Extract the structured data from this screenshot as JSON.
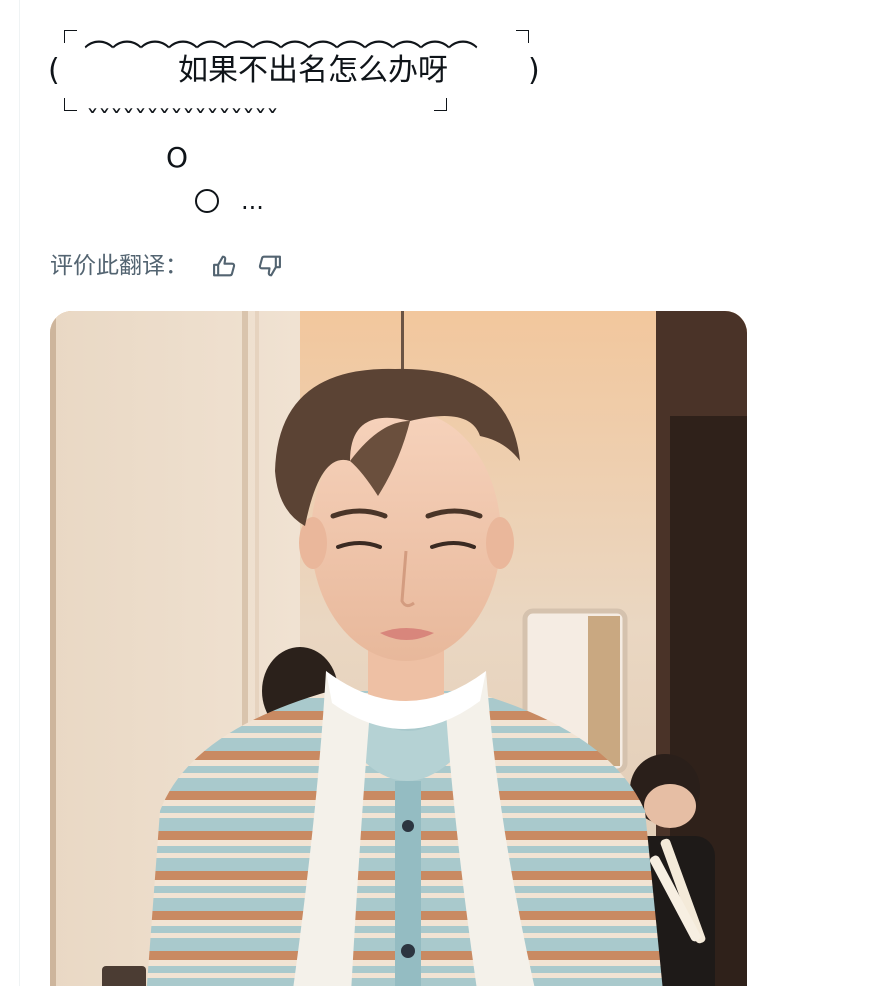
{
  "post": {
    "bubble_top": "︵︵︵︵︵︵︵︵︵︵︵︵︵︵",
    "paren_left": "(",
    "bubble_text": "如果不出名怎么办呀",
    "paren_right": ")",
    "bubble_bottom": "ˇˇˇˇˇˇˇˇˇˇˇˇˇˇˇˇ",
    "small_o": "O",
    "ellipsis": "..."
  },
  "translation_rating": {
    "label": "评价此翻译：",
    "thumbs_up_icon": "thumbs-up-icon",
    "thumbs_down_icon": "thumbs-down-icon"
  },
  "media": {
    "icon": "photo",
    "colors": {
      "wall": "#ead7c2",
      "ceiling_glow": "#f0c39a",
      "door_dark": "#4a3328",
      "sweater_blue": "#9fc4c9",
      "sweater_stripe": "#c98a62",
      "scarf": "#f4f1ea",
      "hair": "#5b4334",
      "skin": "#f2c9b0"
    }
  }
}
